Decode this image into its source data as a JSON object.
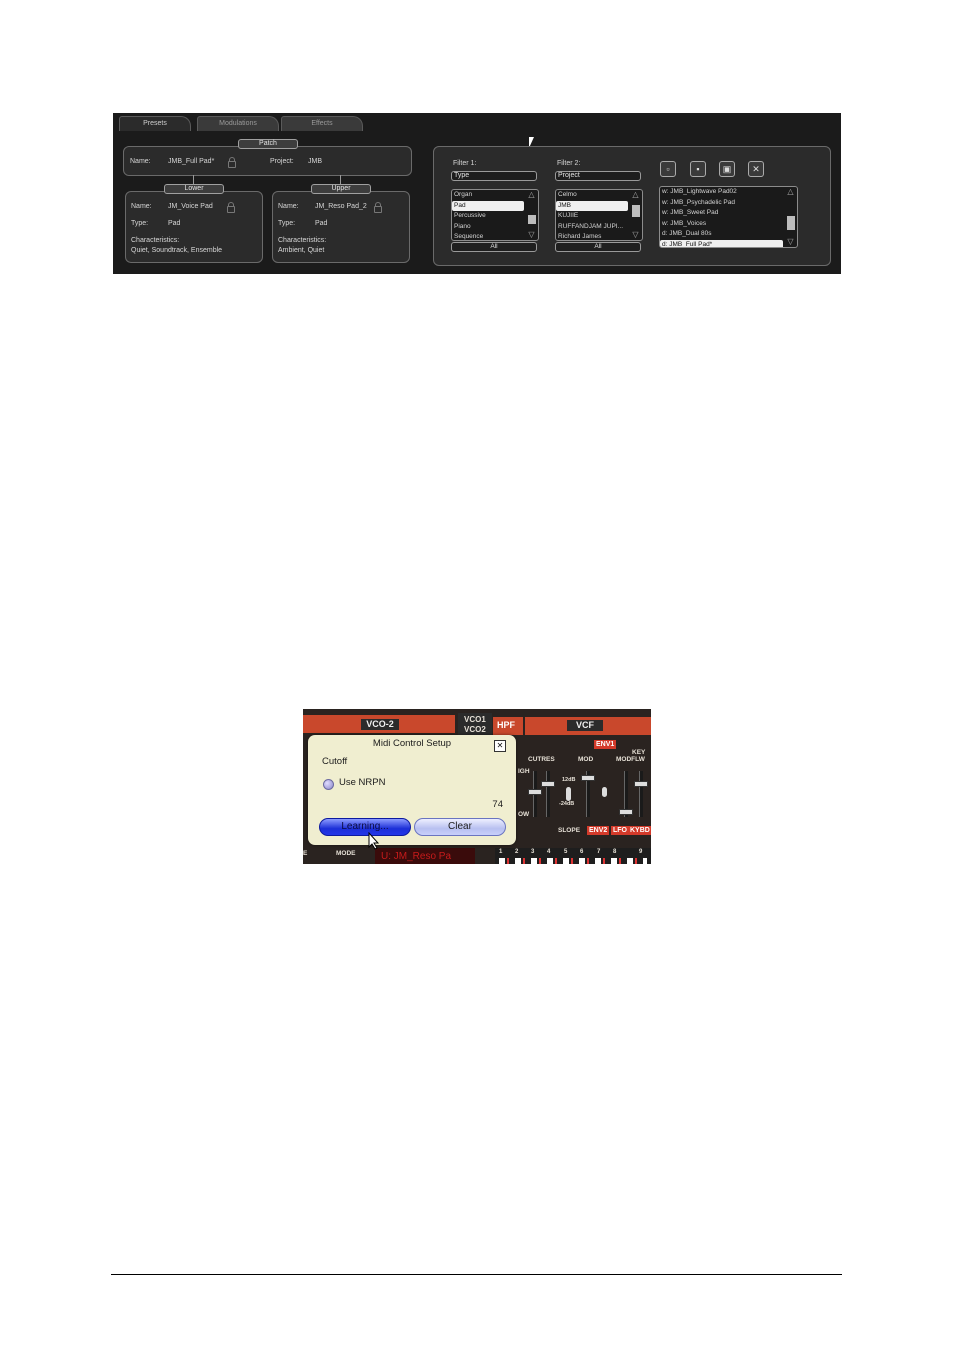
{
  "presets_panel": {
    "tabs": [
      "Presets",
      "Modulations",
      "Effects"
    ],
    "patch": {
      "header": "Patch",
      "name_label": "Name:",
      "name_value": "JMB_Full Pad*",
      "project_label": "Project:",
      "project_value": "JMB"
    },
    "lower": {
      "header": "Lower",
      "name_label": "Name:",
      "name_value": "JM_Voice Pad",
      "type_label": "Type:",
      "type_value": "Pad",
      "characteristics_label": "Characteristics:",
      "characteristics_value": "Quiet, Soundtrack, Ensemble"
    },
    "upper": {
      "header": "Upper",
      "name_label": "Name:",
      "name_value": "JM_Reso Pad_2",
      "type_label": "Type:",
      "type_value": "Pad",
      "characteristics_label": "Characteristics:",
      "characteristics_value": "Ambient, Quiet"
    },
    "filter1": {
      "label": "Filter 1:",
      "value": "Type",
      "items": [
        "Organ",
        "Pad",
        "Percussive",
        "Piano",
        "Sequence"
      ],
      "selected": "Pad",
      "all_label": "All"
    },
    "filter2": {
      "label": "Filter 2:",
      "value": "Project",
      "items": [
        "Celmo",
        "JMB",
        "KUJIIE",
        "RUFFANDJAM JUPI...",
        "Richard James"
      ],
      "selected": "JMB",
      "all_label": "All"
    },
    "results": {
      "items": [
        "w: JMB_Lightwave Pad02",
        "w: JMB_Psychadelic Pad",
        "w: JMB_Sweet Pad",
        "w: JMB_Voices",
        "d: JMB_Dual 80s",
        "d: JMB_Full Pad*"
      ],
      "selected": "d: JMB_Full Pad*"
    },
    "toolbar_icons": [
      "new-icon",
      "save-icon",
      "save-as-icon",
      "delete-icon"
    ]
  },
  "midi_panel": {
    "synth_labels": {
      "vco2": "VCO-2",
      "vco1": "VCO1",
      "vco2b": "VCO2",
      "hpf": "HPF",
      "vcf": "VCF",
      "env1": "ENV1",
      "key": "KEY",
      "cutres": "CUTRES",
      "mod": "MOD",
      "modflw": "MODFLW",
      "high": "IGH",
      "low": "OW",
      "slope": "SLOPE",
      "db12": "12dB",
      "db24": "-24dB",
      "env2": "ENV2",
      "lfo": "LFO",
      "kybd": "KYBD",
      "mode": "MODE",
      "e": "E",
      "patch_display": "U: JM_Reso Pa",
      "steps": [
        "1",
        "2",
        "3",
        "4",
        "5",
        "6",
        "7",
        "8",
        "9"
      ]
    },
    "dialog": {
      "title": "Midi Control Setup",
      "parameter": "Cutoff",
      "nrpn_label": "Use NRPN",
      "value": "74",
      "learn_button": "Learning...",
      "clear_button": "Clear"
    }
  }
}
